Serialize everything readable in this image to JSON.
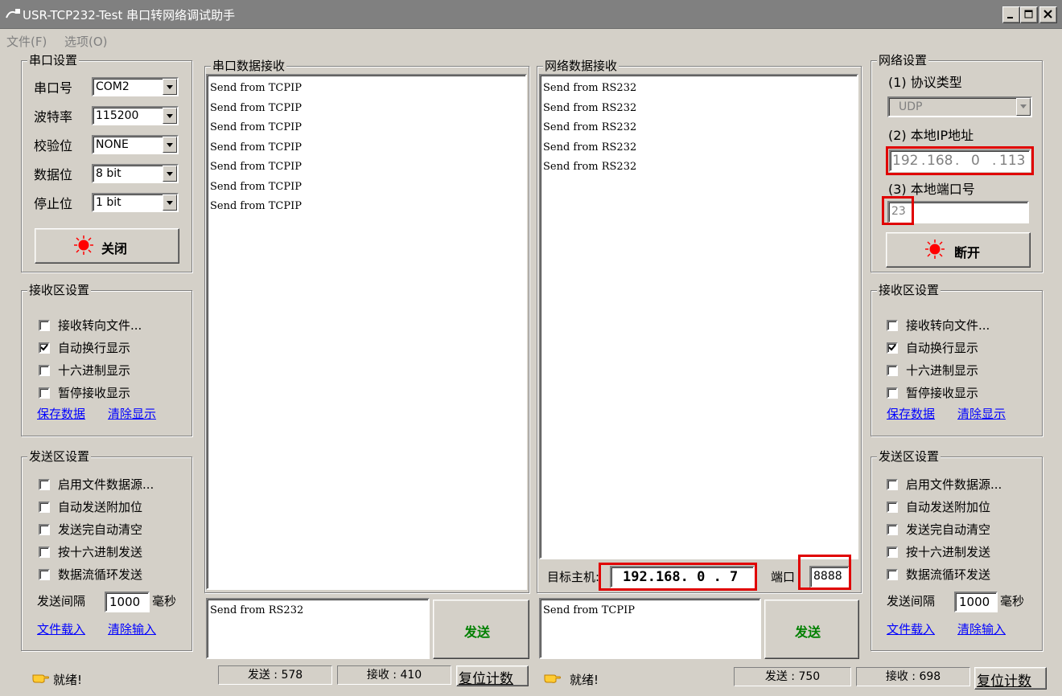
{
  "window": {
    "title": "USR-TCP232-Test 串口转网络调试助手"
  },
  "menu": {
    "file": "文件(F)",
    "options": "选项(O)"
  },
  "serial_settings": {
    "group_label": "串口设置",
    "port_label": "串口号",
    "port_value": "COM2",
    "baud_label": "波特率",
    "baud_value": "115200",
    "parity_label": "校验位",
    "parity_value": "NONE",
    "databits_label": "数据位",
    "databits_value": "8 bit",
    "stopbits_label": "停止位",
    "stopbits_value": "1 bit",
    "close_button": "关闭"
  },
  "left_receive_settings": {
    "group_label": "接收区设置",
    "options": [
      {
        "label": "接收转向文件...",
        "checked": false
      },
      {
        "label": "自动换行显示",
        "checked": true
      },
      {
        "label": "十六进制显示",
        "checked": false
      },
      {
        "label": "暂停接收显示",
        "checked": false
      }
    ],
    "save_link": "保存数据",
    "clear_link": "清除显示"
  },
  "left_send_settings": {
    "group_label": "发送区设置",
    "options": [
      {
        "label": "启用文件数据源...",
        "checked": false
      },
      {
        "label": "自动发送附加位",
        "checked": false
      },
      {
        "label": "发送完自动清空",
        "checked": false
      },
      {
        "label": "按十六进制发送",
        "checked": false
      },
      {
        "label": "数据流循环发送",
        "checked": false
      }
    ],
    "interval_label": "发送间隔",
    "interval_value": "1000",
    "interval_unit": "毫秒",
    "load_link": "文件载入",
    "clear_link": "清除输入"
  },
  "serial_receive": {
    "group_label": "串口数据接收",
    "lines": [
      "Send from TCPIP",
      "Send from TCPIP",
      "Send from TCPIP",
      "Send from TCPIP",
      "Send from TCPIP",
      "Send from TCPIP",
      "Send from TCPIP"
    ]
  },
  "serial_send": {
    "text": "Send from RS232",
    "send_button": "发送"
  },
  "network_receive": {
    "group_label": "网络数据接收",
    "lines": [
      "Send from RS232",
      "Send from RS232",
      "Send from RS232",
      "Send from RS232",
      "Send from RS232"
    ],
    "target_host_label": "目标主机:",
    "target_host_value": "192.168. 0 . 7",
    "port_label": "端口",
    "port_value": "8888"
  },
  "network_send": {
    "text": "Send from TCPIP",
    "send_button": "发送"
  },
  "network_settings": {
    "group_label": "网络设置",
    "protocol_label": "(1) 协议类型",
    "protocol_value": "UDP",
    "ip_label": "(2) 本地IP地址",
    "ip_octets": [
      "192",
      "168",
      "0",
      "113"
    ],
    "local_port_label": "(3) 本地端口号",
    "local_port_value": "23",
    "disconnect_button": "断开"
  },
  "right_receive_settings": {
    "group_label": "接收区设置",
    "options": [
      {
        "label": "接收转向文件...",
        "checked": false
      },
      {
        "label": "自动换行显示",
        "checked": true
      },
      {
        "label": "十六进制显示",
        "checked": false
      },
      {
        "label": "暂停接收显示",
        "checked": false
      }
    ],
    "save_link": "保存数据",
    "clear_link": "清除显示"
  },
  "right_send_settings": {
    "group_label": "发送区设置",
    "options": [
      {
        "label": "启用文件数据源...",
        "checked": false
      },
      {
        "label": "自动发送附加位",
        "checked": false
      },
      {
        "label": "发送完自动清空",
        "checked": false
      },
      {
        "label": "按十六进制发送",
        "checked": false
      },
      {
        "label": "数据流循环发送",
        "checked": false
      }
    ],
    "interval_label": "发送间隔",
    "interval_value": "1000",
    "interval_unit": "毫秒",
    "load_link": "文件载入",
    "clear_link": "清除输入"
  },
  "status_left": {
    "ready": "就绪!",
    "sent": "发送 : 578",
    "received": "接收 : 410",
    "reset_button": "复位计数"
  },
  "status_right": {
    "ready": "就绪!",
    "sent": "发送 : 750",
    "received": "接收 : 698",
    "reset_button": "复位计数"
  },
  "colors": {
    "led_red": "#ff0000",
    "send_green": "#008000",
    "highlight_red": "#e00000",
    "link_blue": "#0000ff"
  }
}
